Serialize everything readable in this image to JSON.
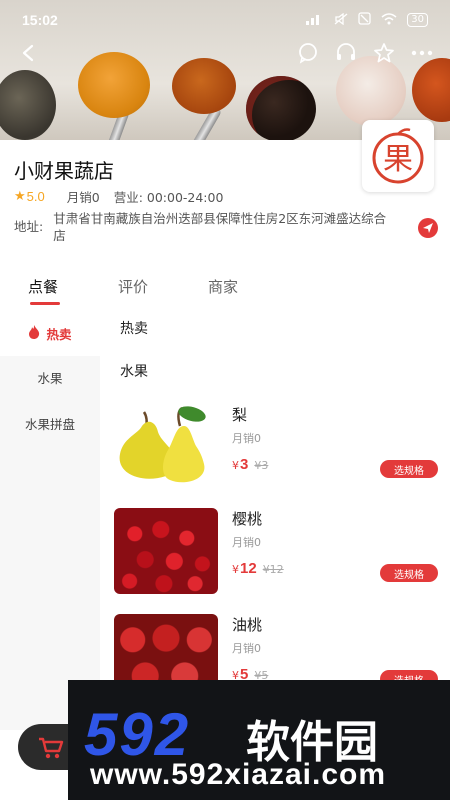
{
  "status_bar": {
    "time": "15:02",
    "battery": "30"
  },
  "store": {
    "name": "小财果蔬店",
    "rating": "5.0",
    "monthly_sales": "月销0",
    "hours": "营业: 00:00-24:00",
    "address_label": "地址:",
    "address": "甘肃省甘南藏族自治州迭部县保障性住房2区东河滩盛达综合店",
    "logo_char": "果"
  },
  "tabs": [
    {
      "label": "点餐"
    },
    {
      "label": "评价"
    },
    {
      "label": "商家"
    }
  ],
  "sidebar": {
    "items": [
      {
        "label": "热卖"
      },
      {
        "label": "水果"
      },
      {
        "label": "水果拼盘"
      }
    ]
  },
  "sections": {
    "hot": "热卖",
    "fruit": "水果"
  },
  "products": [
    {
      "name": "梨",
      "sales": "月销0",
      "currency": "¥",
      "price": "3",
      "original_price": "¥3",
      "button": "选规格"
    },
    {
      "name": "樱桃",
      "sales": "月销0",
      "currency": "¥",
      "price": "12",
      "original_price": "¥12",
      "button": "选规格"
    },
    {
      "name": "油桃",
      "sales": "月销0",
      "currency": "¥",
      "price": "5",
      "original_price": "¥5",
      "button": "选规格"
    }
  ],
  "watermark": {
    "big": "592",
    "cn": "软件园",
    "url": "www.592xiazai.com"
  },
  "colors": {
    "accent": "#e33a3a",
    "rating": "#f6a623",
    "watermark_blue": "#2f56e8"
  },
  "icons": [
    "back-icon",
    "message-icon",
    "headset-icon",
    "star-outline-icon",
    "more-icon",
    "fire-icon",
    "location-arrow-icon",
    "cart-icon"
  ]
}
